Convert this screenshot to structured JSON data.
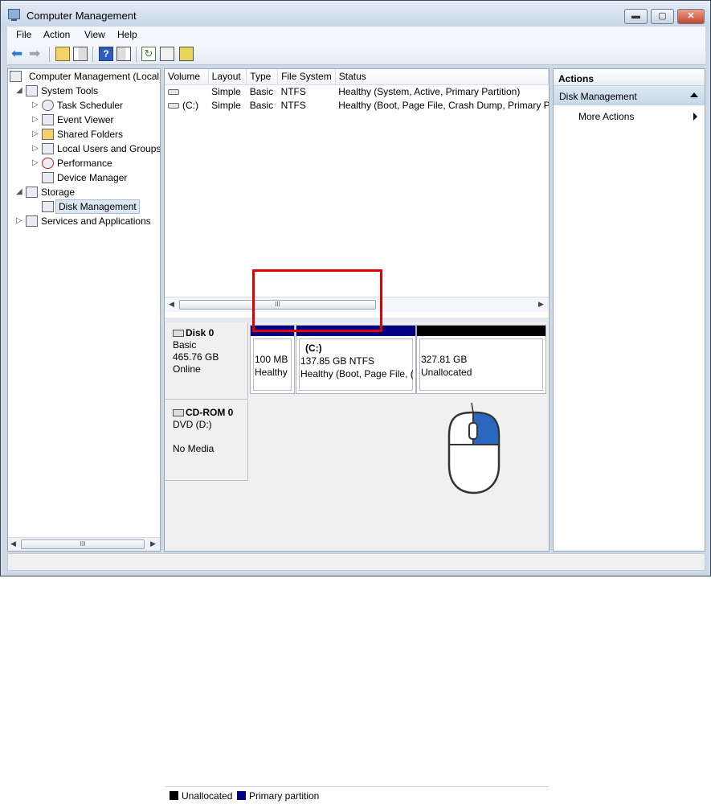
{
  "window": {
    "title": "Computer Management"
  },
  "controls": {
    "minimize": "▬",
    "maximize": "▢",
    "close": "✕"
  },
  "menu": [
    "File",
    "Action",
    "View",
    "Help"
  ],
  "toolbar": {
    "help_glyph": "?",
    "refresh_glyph": "↻"
  },
  "tree": {
    "root": "Computer Management (Local",
    "system_tools": "System Tools",
    "task_scheduler": "Task Scheduler",
    "event_viewer": "Event Viewer",
    "shared_folders": "Shared Folders",
    "local_users": "Local Users and Groups",
    "performance": "Performance",
    "device_manager": "Device Manager",
    "storage": "Storage",
    "disk_management": "Disk Management",
    "services": "Services and Applications"
  },
  "scroll": {
    "grip": "III"
  },
  "volumes": {
    "headers": [
      "Volume",
      "Layout",
      "Type",
      "File System",
      "Status"
    ],
    "rows": [
      {
        "volume": "",
        "layout": "Simple",
        "type": "Basic",
        "fs": "NTFS",
        "status": "Healthy (System, Active, Primary Partition)"
      },
      {
        "volume": "(C:)",
        "layout": "Simple",
        "type": "Basic",
        "fs": "NTFS",
        "status": "Healthy (Boot, Page File, Crash Dump, Primary Pa"
      }
    ]
  },
  "disk0": {
    "name": "Disk 0",
    "type": "Basic",
    "size": "465.76 GB",
    "state": "Online",
    "partitions": [
      {
        "size": "100 MB",
        "status": "Healthy",
        "kind": "primary"
      },
      {
        "name": "(C:)",
        "size": "137.85 GB NTFS",
        "status": "Healthy (Boot, Page File, (",
        "kind": "primary"
      },
      {
        "size": "327.81 GB",
        "status": "Unallocated",
        "kind": "unallocated"
      }
    ]
  },
  "cdrom0": {
    "name": "CD-ROM 0",
    "type": "DVD (D:)",
    "state": "No Media"
  },
  "legend": {
    "unallocated": "Unallocated",
    "primary": "Primary partition"
  },
  "colors": {
    "primary": "#000080",
    "unallocated": "#000000",
    "highlight": "#e00000",
    "mouse_button": "#2a68c0"
  },
  "actions": {
    "header": "Actions",
    "section": "Disk Management",
    "more": "More Actions"
  }
}
